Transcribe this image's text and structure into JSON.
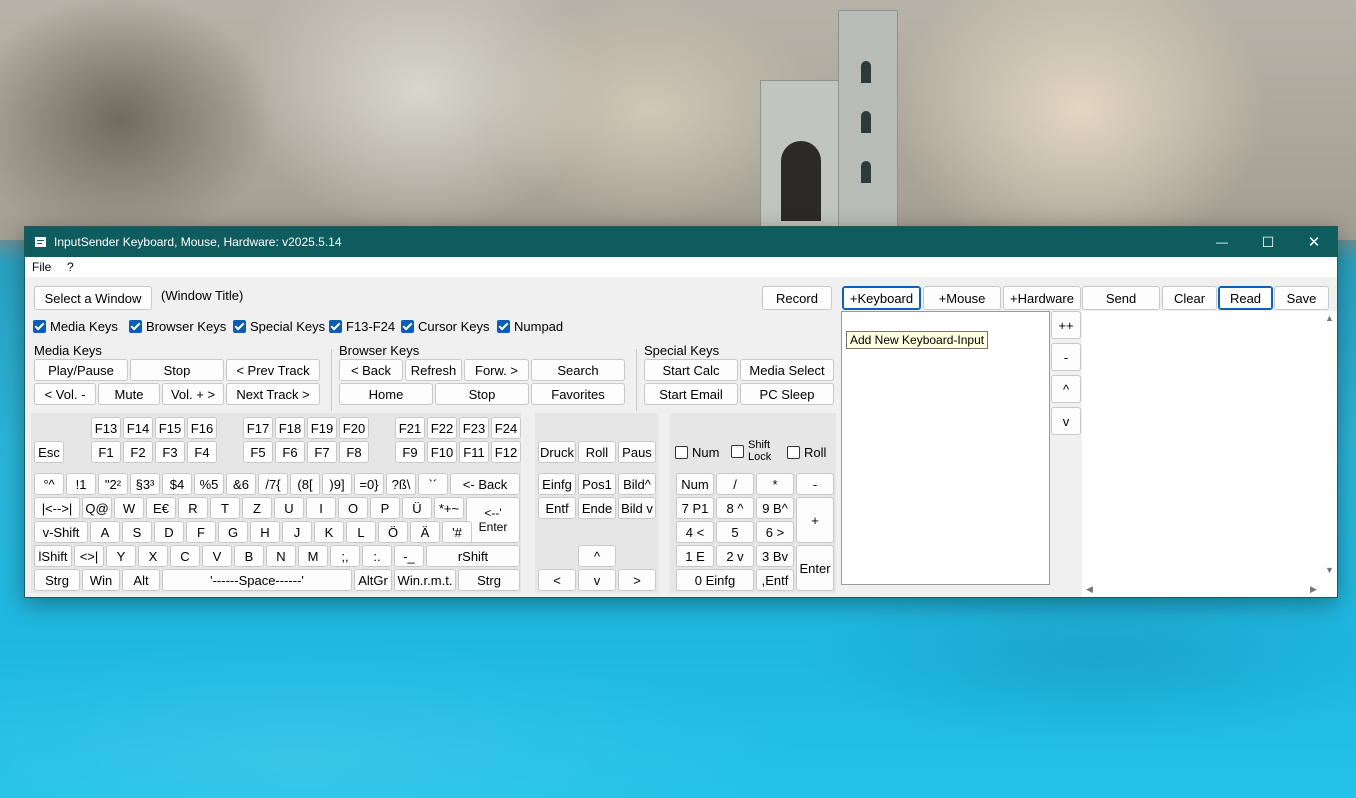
{
  "window": {
    "title": "InputSender Keyboard, Mouse, Hardware: v2025.5.14",
    "controls": {
      "minimize": "—",
      "maximize": "☐",
      "close": "✕"
    }
  },
  "menu": [
    "File",
    "?"
  ],
  "top": {
    "select_window": "Select a Window",
    "window_title": "(Window Title)",
    "record": "Record",
    "add_keyboard": "+Keyboard",
    "add_mouse": "+Mouse",
    "add_hardware": "+Hardware",
    "send": "Send",
    "clear": "Clear",
    "read": "Read",
    "save": "Save"
  },
  "checkboxes": [
    "Media Keys",
    "Browser Keys",
    "Special Keys",
    "F13-F24",
    "Cursor Keys",
    "Numpad"
  ],
  "media": {
    "heading": "Media Keys",
    "keys": [
      "Play/Pause",
      "Stop",
      "< Prev Track",
      "< Vol. -",
      "Mute",
      "Vol. + >",
      "Next Track >"
    ]
  },
  "browser": {
    "heading": "Browser Keys",
    "keys": [
      "< Back",
      "Refresh",
      "Forw. >",
      "Search",
      "Home",
      "Stop",
      "Favorites"
    ]
  },
  "special": {
    "heading": "Special Keys",
    "keys": [
      "Start Calc",
      "Media Select",
      "Start Email",
      "PC Sleep"
    ]
  },
  "fkeys": {
    "esc": "Esc",
    "row_hi": [
      "F13",
      "F14",
      "F15",
      "F16",
      "F17",
      "F18",
      "F19",
      "F20",
      "F21",
      "F22",
      "F23",
      "F24"
    ],
    "row_lo": [
      "F1",
      "F2",
      "F3",
      "F4",
      "F5",
      "F6",
      "F7",
      "F8",
      "F9",
      "F10",
      "F11",
      "F12"
    ]
  },
  "main": {
    "row1": [
      "°^",
      "!1",
      "\"2²",
      "§3³",
      "$4",
      "%5",
      "&6",
      "/7{",
      "(8[",
      ")9]",
      "=0}",
      "?ß\\",
      "`´",
      "<- Back"
    ],
    "row2": [
      "|<-->|",
      "Q@",
      "W",
      "E€",
      "R",
      "T",
      "Z",
      "U",
      "I",
      "O",
      "P",
      "Ü",
      "*+~",
      "<--'"
    ],
    "enter": "Enter",
    "row3": [
      "v-Shift",
      "A",
      "S",
      "D",
      "F",
      "G",
      "H",
      "J",
      "K",
      "L",
      "Ö",
      "Ä",
      "'#"
    ],
    "row4": [
      "lShift",
      "<>|",
      "Y",
      "X",
      "C",
      "V",
      "B",
      "N",
      "M",
      ";,",
      ":.",
      "-_",
      "rShift"
    ],
    "row5": [
      "Strg",
      "Win",
      "Alt",
      "'------Space------'",
      "AltGr",
      "Win.r.m.t.",
      "Strg"
    ]
  },
  "cursor": {
    "top": [
      "Druck",
      "Roll",
      "Paus"
    ],
    "mid1": [
      "Einfg",
      "Pos1",
      "Bild^"
    ],
    "mid2": [
      "Entf",
      "Ende",
      "Bild v"
    ],
    "up": "^",
    "bottom": [
      "<",
      "v",
      ">"
    ]
  },
  "numpad": {
    "locks": [
      "Num",
      "Shift Lock",
      "Roll"
    ],
    "row1": [
      "Num",
      "/",
      "*",
      "-"
    ],
    "row2": [
      "7 P1",
      "8 ^",
      "9 B^"
    ],
    "plus": "+",
    "row3": [
      "4 <",
      "5",
      "6 >"
    ],
    "row4": [
      "1 E",
      "2 v",
      "3 Bv"
    ],
    "enter": "Enter",
    "row5": [
      "0 Einfg",
      ",Entf"
    ]
  },
  "list": {
    "tooltip": "Add New Keyboard-Input",
    "side": [
      "++",
      "-",
      "^",
      "v"
    ]
  }
}
